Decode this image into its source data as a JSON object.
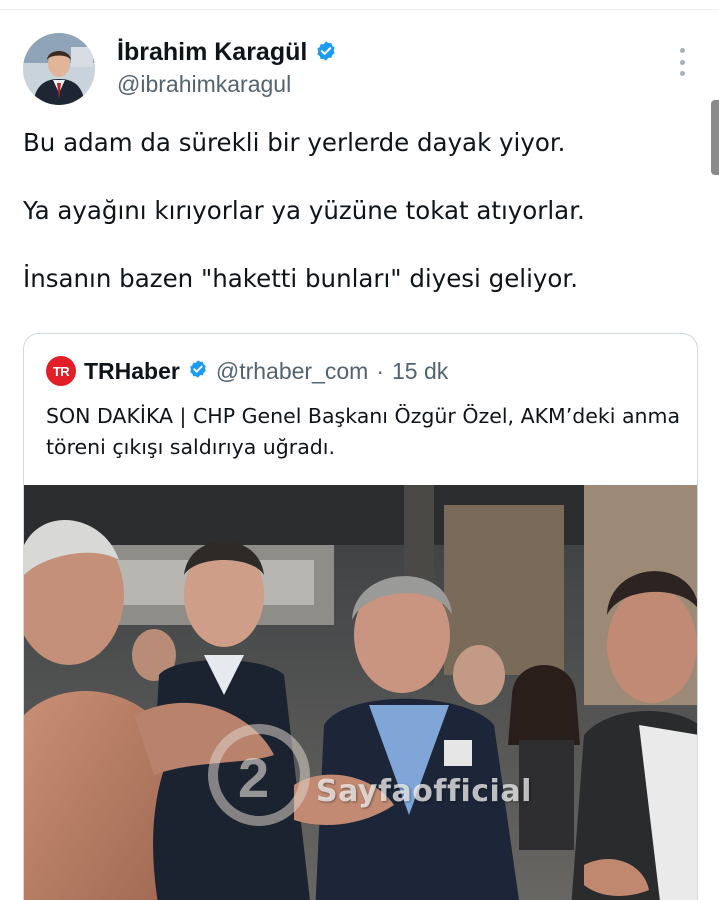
{
  "author": {
    "name": "İbrahim Karagül",
    "handle": "@ibrahimkaragul",
    "verified_color": "#1d9bf0"
  },
  "tweet": {
    "lines": [
      "Bu adam da sürekli bir yerlerde dayak yiyor.",
      "Ya ayağını kırıyorlar ya yüzüne tokat atıyorlar.",
      "İnsanın bazen \"haketti bunları\" diyesi geliyor."
    ]
  },
  "quote": {
    "logo_text": "TR",
    "name": "TRHaber",
    "handle": "@trhaber_com",
    "separator": "·",
    "time": "15 dk",
    "text": "SON DAKİKA | CHP Genel Başkanı Özgür Özel, AKM’deki anma töreni çıkışı saldırıya uğradı.",
    "media": {
      "watermark": "Sayfaofficial"
    }
  },
  "colors": {
    "text": "#0f1419",
    "secondary": "#536471",
    "border": "#cfd9de",
    "verified": "#1d9bf0",
    "trhaber_logo": "#e21f26"
  },
  "icons": [
    "verified-badge-icon",
    "more-options-icon",
    "trhaber-logo-icon"
  ]
}
